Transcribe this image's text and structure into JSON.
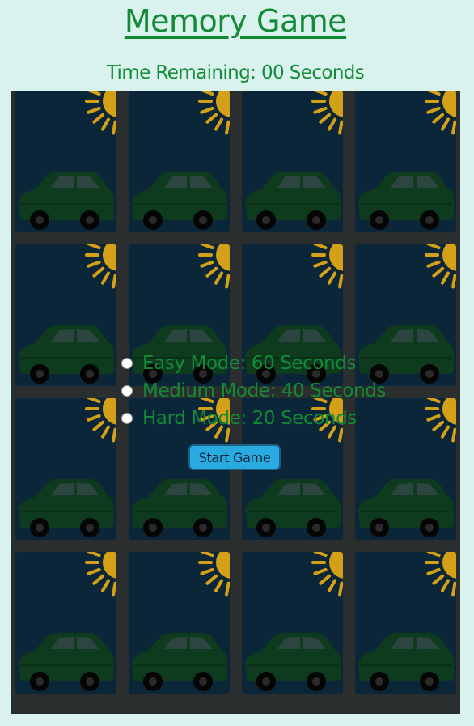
{
  "game": {
    "title": "Memory Game",
    "timer": "Time Remaining: 00 Seconds",
    "card_back_picture": "car-under-sun",
    "card_count": 16
  },
  "modes": [
    {
      "label": "Easy Mode: 60 Seconds",
      "checked": false
    },
    {
      "label": "Medium Mode: 40 Seconds",
      "checked": false
    },
    {
      "label": "Hard Mode: 20 Seconds",
      "checked": false
    }
  ],
  "controls": {
    "start_label": "Start Game"
  },
  "colors": {
    "page_background": "#d9f2ee",
    "text_green": "#138a36",
    "board": "#2b2e2e",
    "card_back": "#0b2638",
    "sun": "#d4a017",
    "car": "#0e3a1e",
    "button": "#29abe2"
  }
}
